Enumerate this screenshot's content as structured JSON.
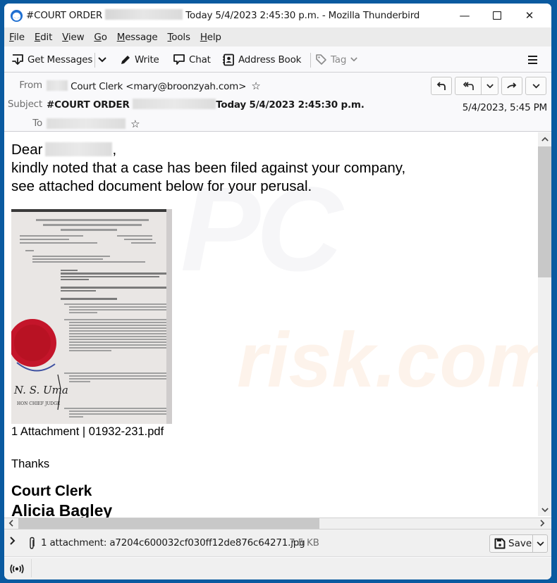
{
  "window": {
    "title_prefix": "#COURT ORDER",
    "title_suffix": "Today 5/4/2023 2:45:30 p.m. - Mozilla Thunderbird",
    "minimize_glyph": "—",
    "maximize_glyph": "☐",
    "close_glyph": "✕"
  },
  "menubar": {
    "items": [
      {
        "accel": "F",
        "rest": "ile"
      },
      {
        "accel": "E",
        "rest": "dit"
      },
      {
        "accel": "V",
        "rest": "iew"
      },
      {
        "accel": "G",
        "rest": "o"
      },
      {
        "accel": "M",
        "rest": "essage"
      },
      {
        "accel": "T",
        "rest": "ools"
      },
      {
        "accel": "H",
        "rest": "elp"
      }
    ]
  },
  "toolbar": {
    "get_messages": "Get Messages",
    "write": "Write",
    "chat": "Chat",
    "address_book": "Address Book",
    "tag": "Tag"
  },
  "header": {
    "from_label": "From",
    "from_value": "Court Clerk <mary@broonzyah.com>",
    "subject_label": "Subject",
    "subject_prefix": "#COURT ORDER",
    "subject_suffix": "Today 5/4/2023 2:45:30 p.m.",
    "to_label": "To",
    "date": "5/4/2023, 5:45 PM"
  },
  "message": {
    "greeting": "Dear",
    "greeting_punct": ",",
    "line1": "kindly noted that a case has been filed against your company,",
    "line2": "see attached document below for your perusal.",
    "attachment_caption": "1 Attachment | 01932-231.pdf",
    "thanks": "Thanks",
    "signature_title": "Court Clerk",
    "signature_name": "Alicia Bagley",
    "document_image_alt": "Scanned court order document with red seal",
    "document_signature_text": "N. S. Uma",
    "document_footer_text": "HON CHIEF JUDGE"
  },
  "attachments": {
    "summary": "1 attachment: a7204c600032cf030ff12de876c64271.jpg",
    "size": "7.5 KB",
    "save_label": "Save"
  },
  "watermark": {
    "text1": "PC",
    "text2": "risk.com"
  }
}
